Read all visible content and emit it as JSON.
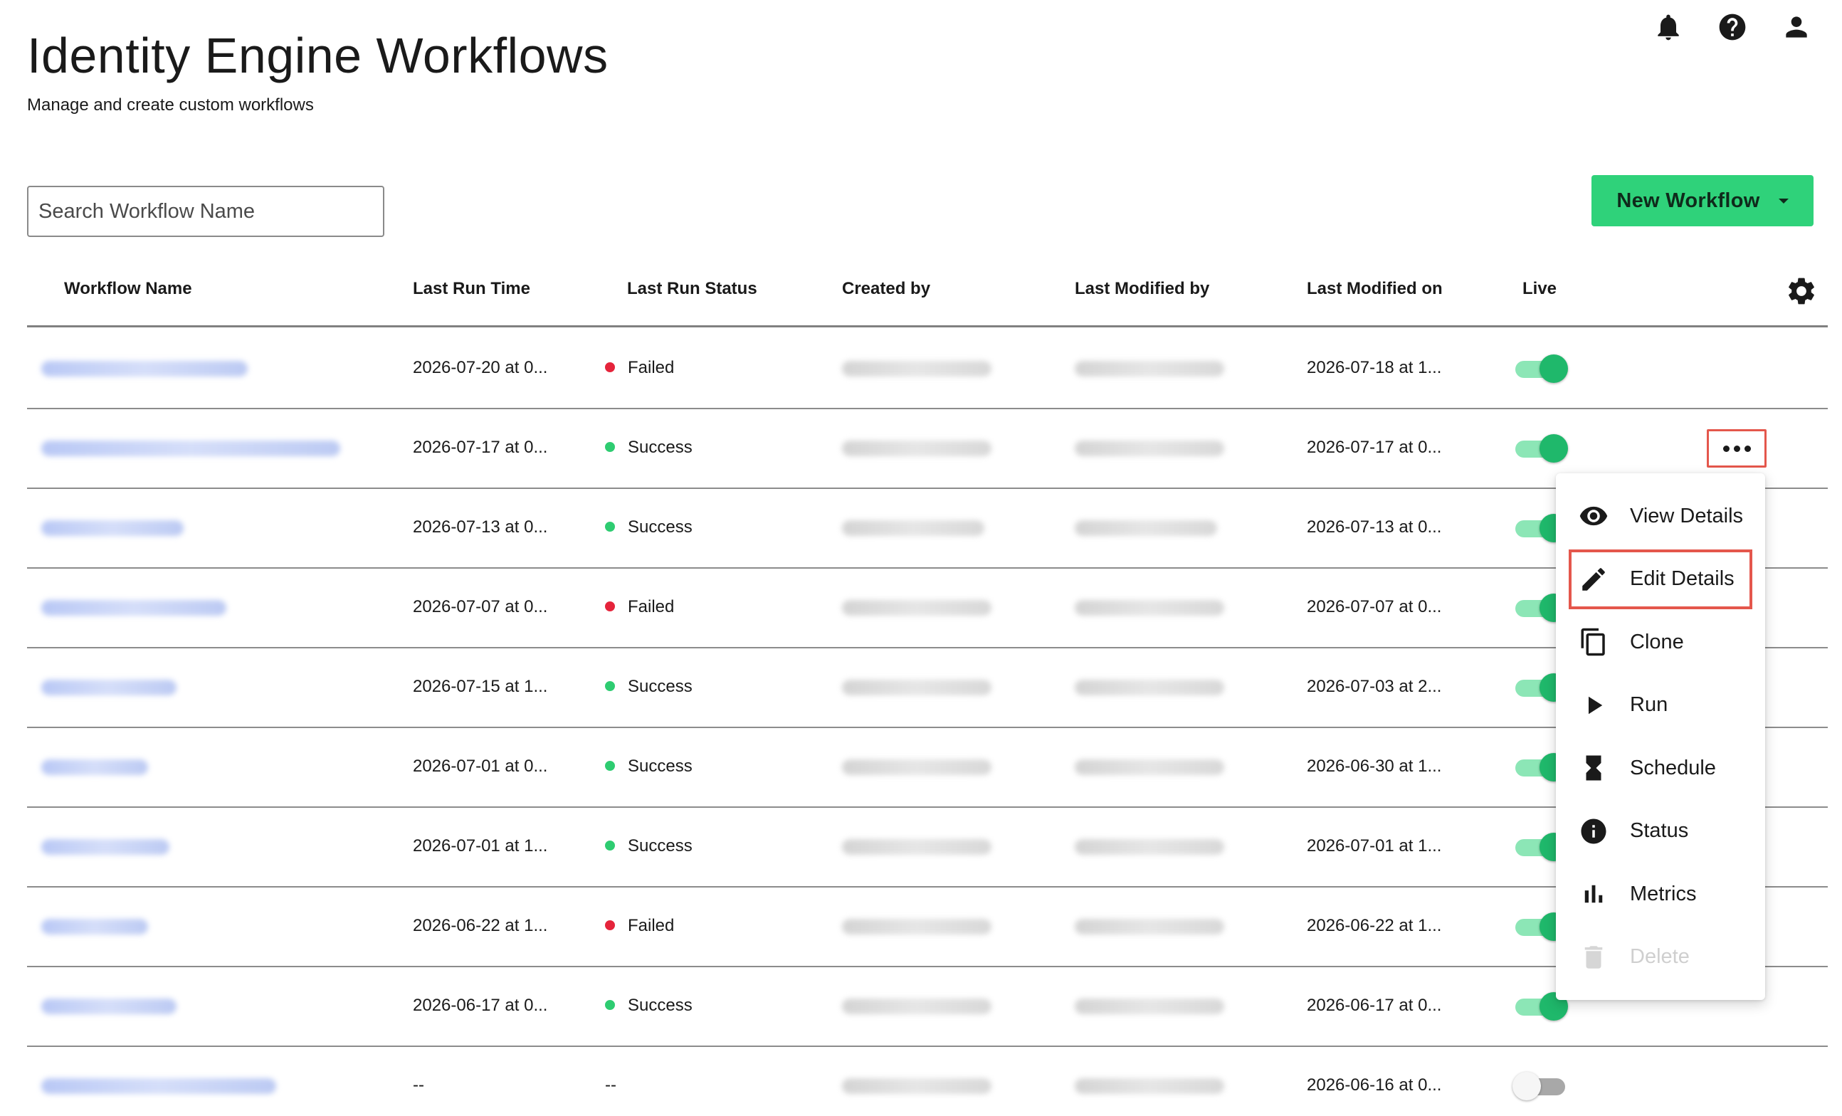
{
  "page": {
    "title": "Identity Engine Workflows",
    "subtitle": "Manage and create custom workflows"
  },
  "header_icons": [
    "bell-icon",
    "help-icon",
    "user-icon"
  ],
  "search": {
    "placeholder": "Search Workflow Name",
    "value": ""
  },
  "new_workflow": {
    "label": "New Workflow"
  },
  "table": {
    "columns": [
      "Workflow Name",
      "Last Run Time",
      "Last Run Status",
      "Created by",
      "Last Modified by",
      "Last Modified on",
      "Live"
    ],
    "rows": [
      {
        "last_run_time": "2026-07-20 at 0...",
        "status": "Failed",
        "status_color": "#e5243b",
        "modified_on": "2026-07-18 at 1...",
        "live": true
      },
      {
        "last_run_time": "2026-07-17 at 0...",
        "status": "Success",
        "status_color": "#2ecc71",
        "modified_on": "2026-07-17 at 0...",
        "live": true
      },
      {
        "last_run_time": "2026-07-13 at 0...",
        "status": "Success",
        "status_color": "#2ecc71",
        "modified_on": "2026-07-13 at 0...",
        "live": true
      },
      {
        "last_run_time": "2026-07-07 at 0...",
        "status": "Failed",
        "status_color": "#e5243b",
        "modified_on": "2026-07-07 at 0...",
        "live": true
      },
      {
        "last_run_time": "2026-07-15 at 1...",
        "status": "Success",
        "status_color": "#2ecc71",
        "modified_on": "2026-07-03 at 2...",
        "live": true
      },
      {
        "last_run_time": "2026-07-01 at 0...",
        "status": "Success",
        "status_color": "#2ecc71",
        "modified_on": "2026-06-30 at 1...",
        "live": true
      },
      {
        "last_run_time": "2026-07-01 at 1...",
        "status": "Success",
        "status_color": "#2ecc71",
        "modified_on": "2026-07-01 at 1...",
        "live": true
      },
      {
        "last_run_time": "2026-06-22 at 1...",
        "status": "Failed",
        "status_color": "#e5243b",
        "modified_on": "2026-06-22 at 1...",
        "live": true
      },
      {
        "last_run_time": "2026-06-17 at 0...",
        "status": "Success",
        "status_color": "#2ecc71",
        "modified_on": "2026-06-17 at 0...",
        "live": true
      },
      {
        "last_run_time": "--",
        "status": "--",
        "status_color": "",
        "modified_on": "2026-06-16 at 0...",
        "live": false
      }
    ]
  },
  "context_menu": {
    "items": [
      {
        "label": "View Details",
        "icon": "eye-icon"
      },
      {
        "label": "Edit Details",
        "icon": "pencil-icon"
      },
      {
        "label": "Clone",
        "icon": "copy-icon"
      },
      {
        "label": "Run",
        "icon": "play-icon"
      },
      {
        "label": "Schedule",
        "icon": "hourglass-icon"
      },
      {
        "label": "Status",
        "icon": "info-icon"
      },
      {
        "label": "Metrics",
        "icon": "bar-chart-icon"
      },
      {
        "label": "Delete",
        "icon": "trash-icon"
      }
    ]
  },
  "colors": {
    "accent_green": "#2fd27a",
    "toggle_on": "#1fb86b",
    "success": "#2ecc71",
    "failed": "#e5243b",
    "highlight_outline": "#e4574c"
  }
}
